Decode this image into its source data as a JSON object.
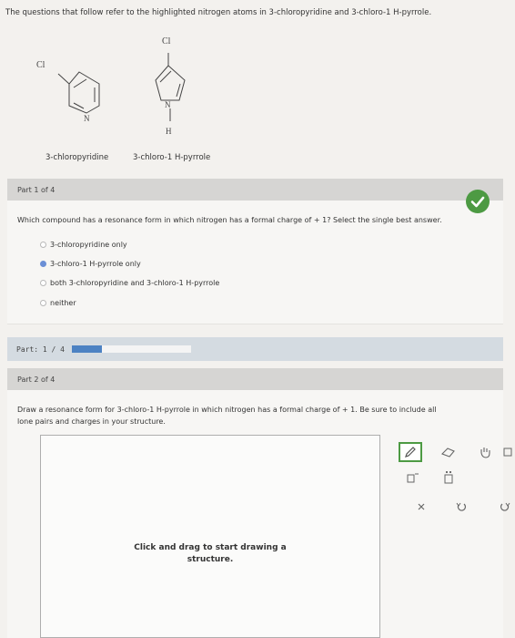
{
  "intro_text": "The questions that follow refer to the highlighted nitrogen atoms in 3-chloropyridine and 3-chloro-1 H-pyrrole.",
  "structures": {
    "pyridine": {
      "substituent": "Cl",
      "heteroatom": "N",
      "name": "3-chloropyridine"
    },
    "pyrrole": {
      "substituent": "Cl",
      "heteroatom": "N",
      "nh_hydrogen": "H",
      "name": "3-chloro-1 H-pyrrole"
    }
  },
  "part1": {
    "header": "Part 1 of 4",
    "question": "Which compound has a resonance form in which nitrogen has a formal charge of + 1? Select the single best answer.",
    "options": [
      {
        "label": "3-chloropyridine only",
        "selected": false
      },
      {
        "label": "3-chloro-1 H-pyrrole only",
        "selected": true
      },
      {
        "label": "both 3-chloropyridine and 3-chloro-1 H-pyrrole",
        "selected": false
      },
      {
        "label": "neither",
        "selected": false
      }
    ],
    "status_icon": "checkmark-icon",
    "correct_color": "#4d9a43"
  },
  "progress": {
    "label": "Part: 1 / 4",
    "fraction": 0.25,
    "color": "#4c82c3"
  },
  "part2": {
    "header": "Part 2 of 4",
    "question_line1": "Draw a resonance form for 3-chloro-1 H-pyrrole in which nitrogen has a formal charge of + 1. Be sure to include all",
    "question_line2": "lone pairs and charges in your structure.",
    "canvas_hint_line1": "Click and drag to start drawing a",
    "canvas_hint_line2": "structure."
  },
  "toolbar": {
    "tools": [
      {
        "icon": "pencil-icon",
        "active": true
      },
      {
        "icon": "eraser-icon",
        "active": false
      },
      {
        "icon": "grab-hand-icon",
        "active": false
      },
      {
        "icon": "template-icon",
        "active": false
      },
      {
        "icon": "charge-icon",
        "active": false
      },
      {
        "icon": "lone-pair-icon",
        "active": false
      },
      {
        "icon": "clear-icon",
        "active": false
      },
      {
        "icon": "undo-icon",
        "active": false
      },
      {
        "icon": "redo-icon",
        "active": false
      }
    ],
    "accent": "#4d9a43"
  }
}
